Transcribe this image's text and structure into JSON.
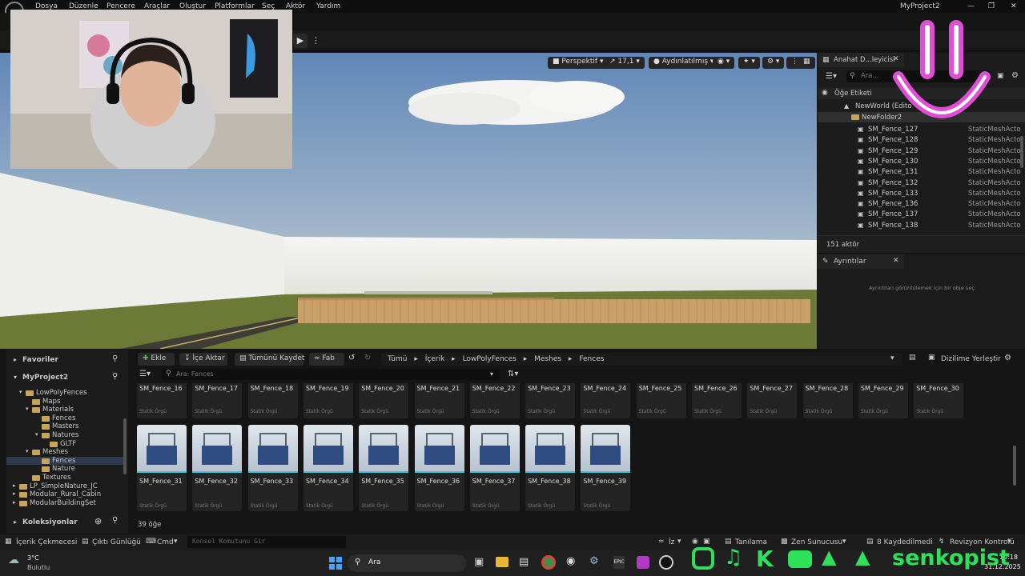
{
  "menubar": {
    "items": [
      "Dosya",
      "Düzenle",
      "Pencere",
      "Araçlar",
      "Oluştur",
      "Platformlar",
      "Seç",
      "Aktör",
      "Yardım"
    ],
    "project_title": "MyProject2"
  },
  "viewport": {
    "perspective_label": "Perspektif",
    "fov_label": "17,1",
    "lit_label": "Aydınlatılmış"
  },
  "outliner": {
    "tab_label": "Anahat D...leyicisi",
    "search_placeholder": "Ara...",
    "column_label": "Öğe Etiketi",
    "world_label": "NewWorld (Edito",
    "folder_label": "NewFolder2",
    "rows": [
      {
        "name": "SM_Fence_127",
        "type": "StaticMeshActo"
      },
      {
        "name": "SM_Fence_128",
        "type": "StaticMeshActo"
      },
      {
        "name": "SM_Fence_129",
        "type": "StaticMeshActo"
      },
      {
        "name": "SM_Fence_130",
        "type": "StaticMeshActo"
      },
      {
        "name": "SM_Fence_131",
        "type": "StaticMeshActo"
      },
      {
        "name": "SM_Fence_132",
        "type": "StaticMeshActo"
      },
      {
        "name": "SM_Fence_133",
        "type": "StaticMeshActo"
      },
      {
        "name": "SM_Fence_136",
        "type": "StaticMeshActo"
      },
      {
        "name": "SM_Fence_137",
        "type": "StaticMeshActo"
      },
      {
        "name": "SM_Fence_138",
        "type": "StaticMeshActo"
      }
    ],
    "actor_count": "151 aktör"
  },
  "details": {
    "tab_label": "Ayrıntılar",
    "empty_text": "Ayrıntıları görüntülemek için bir obje seç."
  },
  "content": {
    "favorites_label": "Favoriler",
    "project_label": "MyProject2",
    "collections_label": "Koleksiyonlar",
    "add_label": "Ekle",
    "import_label": "İçe Aktar",
    "save_all_label": "Tümünü Kaydet",
    "fab_label": "Fab",
    "breadcrumb": [
      "Tümü",
      "İçerik",
      "LowPolyFences",
      "Meshes",
      "Fences"
    ],
    "dock_label": "Dizilime Yerleştir",
    "search_placeholder": "Ara: Fences",
    "tree": [
      {
        "label": "LowPolyFences"
      },
      {
        "label": "Maps"
      },
      {
        "label": "Materials"
      },
      {
        "label": "Fences"
      },
      {
        "label": "Masters"
      },
      {
        "label": "Natures"
      },
      {
        "label": "GLTF"
      },
      {
        "label": "Meshes"
      },
      {
        "label": "Fences"
      },
      {
        "label": "Nature"
      },
      {
        "label": "Textures"
      },
      {
        "label": "LP_SimpleNature_JC"
      },
      {
        "label": "Modular_Rural_Cabin"
      },
      {
        "label": "ModularBuildingSet"
      }
    ],
    "row1": [
      "SM_Fence_16",
      "SM_Fence_17",
      "SM_Fence_18",
      "SM_Fence_19",
      "SM_Fence_20",
      "SM_Fence_21",
      "SM_Fence_22",
      "SM_Fence_23",
      "SM_Fence_24",
      "SM_Fence_25",
      "SM_Fence_26",
      "SM_Fence_27",
      "SM_Fence_28",
      "SM_Fence_29",
      "SM_Fence_30"
    ],
    "row2": [
      "SM_Fence_31",
      "SM_Fence_32",
      "SM_Fence_33",
      "SM_Fence_34",
      "SM_Fence_35",
      "SM_Fence_36",
      "SM_Fence_37",
      "SM_Fence_38",
      "SM_Fence_39"
    ],
    "asset_type": "Statik Örgü",
    "item_count": "39 öğe"
  },
  "statusbar": {
    "content_drawer": "İçerik Çekmecesi",
    "output_log": "Çıktı Günlüğü",
    "cmd_label": "Cmd",
    "console_placeholder": "Konsol Komutunu Gir",
    "trace_label": "İz",
    "derive_label": "Tanılama",
    "zen_label": "Zen Sunucusu",
    "unsaved_label": "8 Kaydedilmedi",
    "revision_label": "Revizyon Kontrolü"
  },
  "taskbar": {
    "temp": "3°C",
    "weather": "Bulutlu",
    "search_label": "Ara",
    "time": "10:18",
    "date": "31.12.2025"
  },
  "overlay": {
    "brand_text": "senkopist"
  }
}
